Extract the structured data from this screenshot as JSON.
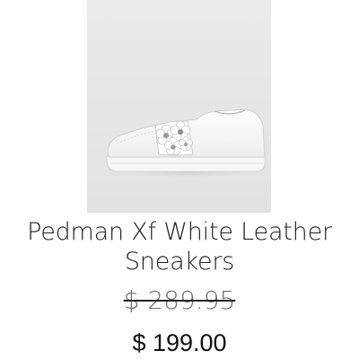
{
  "product": {
    "title": "Pedman Xf White Leather Sneakers",
    "image_alt": "white leather sneaker with floral embellishment",
    "price_original": "$ 289.95",
    "price_sale": "$ 199.00"
  },
  "colors": {
    "image_background": "#e6e6e6",
    "text": "#222222",
    "strikethrough_price": "#6f6f6f"
  }
}
